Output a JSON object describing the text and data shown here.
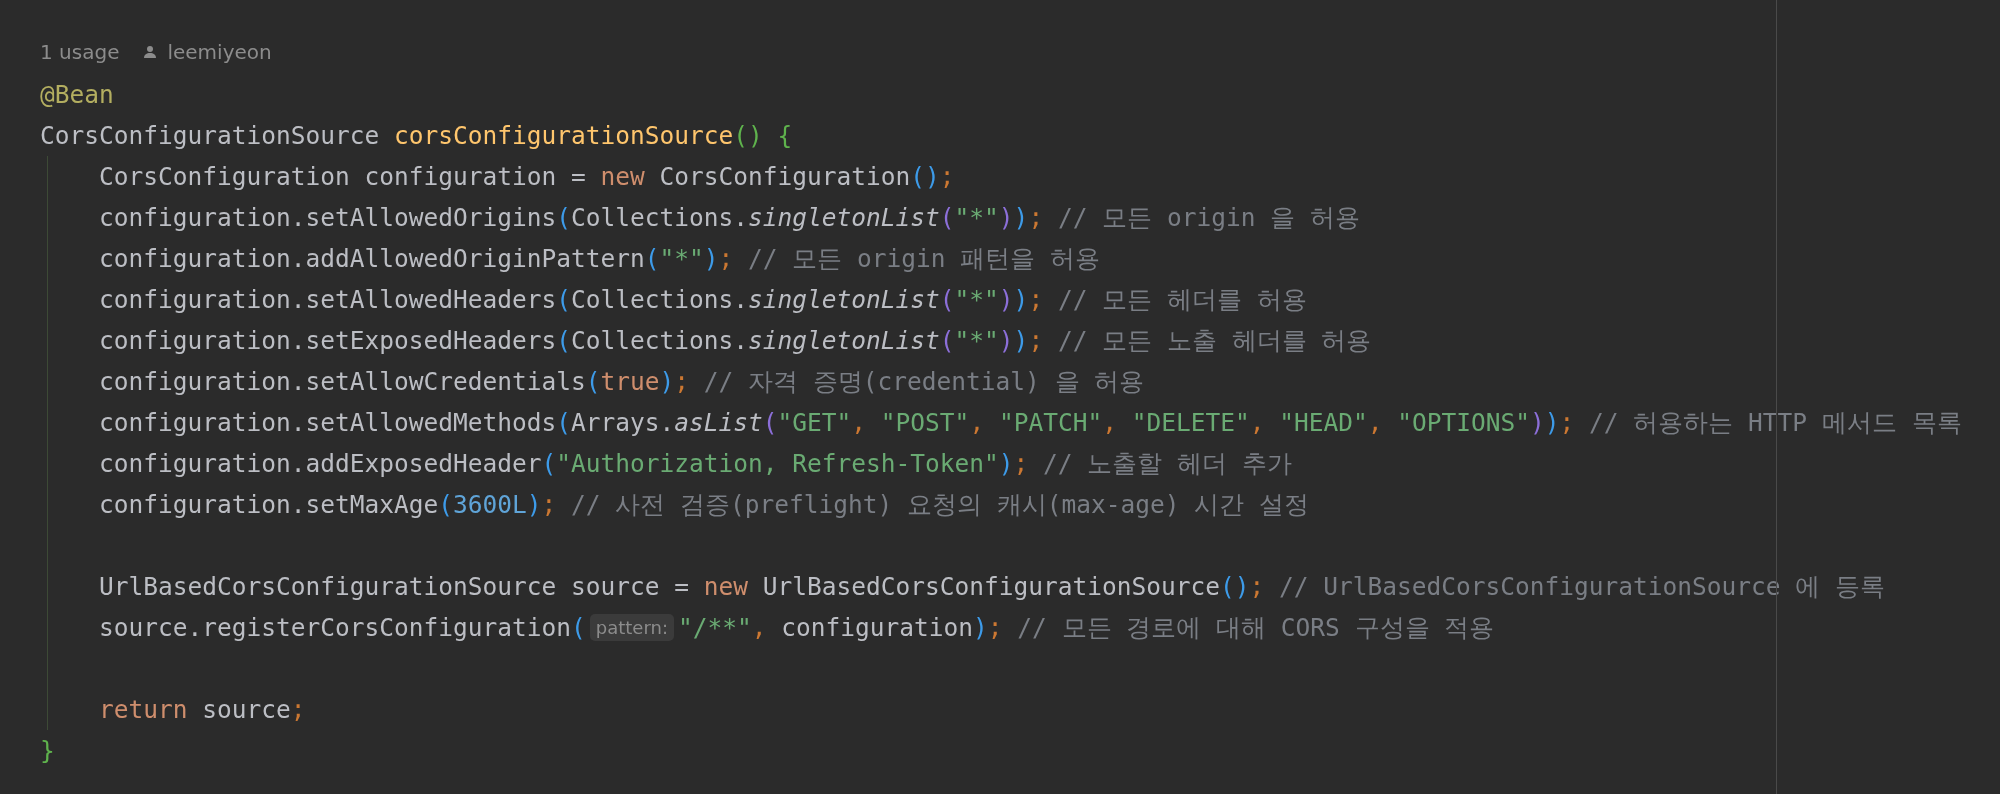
{
  "inlay": {
    "usages": "1 usage",
    "author": "leemiyeon"
  },
  "code": [
    {
      "kind": "code",
      "tokens": [
        {
          "kind": "annotation",
          "text": "@Bean"
        }
      ]
    },
    {
      "kind": "code",
      "tokens": [
        {
          "kind": "plain",
          "text": "CorsConfigurationSource "
        },
        {
          "kind": "declaration",
          "text": "corsConfigurationSource"
        },
        {
          "kind": "brace",
          "text": "()"
        },
        {
          "kind": "brace",
          "text": " {"
        }
      ],
      "children": [
        {
          "kind": "code",
          "tokens": [
            {
              "kind": "plain",
              "text": "CorsConfiguration configuration = "
            },
            {
              "kind": "keyword",
              "text": "new"
            },
            {
              "kind": "plain",
              "text": " CorsConfiguration"
            },
            {
              "kind": "paren1",
              "text": "()"
            },
            {
              "kind": "punct",
              "text": ";"
            }
          ]
        },
        {
          "kind": "code",
          "tokens": [
            {
              "kind": "plain",
              "text": "configuration.setAllowedOrigins"
            },
            {
              "kind": "paren1",
              "text": "("
            },
            {
              "kind": "plain",
              "text": "Collections."
            },
            {
              "kind": "static",
              "text": "singletonList"
            },
            {
              "kind": "paren2",
              "text": "("
            },
            {
              "kind": "string",
              "text": "\"*\""
            },
            {
              "kind": "paren2",
              "text": ")"
            },
            {
              "kind": "paren1",
              "text": ")"
            },
            {
              "kind": "punct",
              "text": ";"
            },
            {
              "kind": "comment",
              "text": " // 모든 origin 을 허용"
            }
          ]
        },
        {
          "kind": "code",
          "tokens": [
            {
              "kind": "plain",
              "text": "configuration.addAllowedOriginPattern"
            },
            {
              "kind": "paren1",
              "text": "("
            },
            {
              "kind": "string",
              "text": "\"*\""
            },
            {
              "kind": "paren1",
              "text": ")"
            },
            {
              "kind": "punct",
              "text": ";"
            },
            {
              "kind": "comment",
              "text": " // 모든 origin 패턴을 허용"
            }
          ]
        },
        {
          "kind": "code",
          "tokens": [
            {
              "kind": "plain",
              "text": "configuration.setAllowedHeaders"
            },
            {
              "kind": "paren1",
              "text": "("
            },
            {
              "kind": "plain",
              "text": "Collections."
            },
            {
              "kind": "static",
              "text": "singletonList"
            },
            {
              "kind": "paren2",
              "text": "("
            },
            {
              "kind": "string",
              "text": "\"*\""
            },
            {
              "kind": "paren2",
              "text": ")"
            },
            {
              "kind": "paren1",
              "text": ")"
            },
            {
              "kind": "punct",
              "text": ";"
            },
            {
              "kind": "comment",
              "text": " // 모든 헤더를 허용"
            }
          ]
        },
        {
          "kind": "code",
          "tokens": [
            {
              "kind": "plain",
              "text": "configuration.setExposedHeaders"
            },
            {
              "kind": "paren1",
              "text": "("
            },
            {
              "kind": "plain",
              "text": "Collections."
            },
            {
              "kind": "static",
              "text": "singletonList"
            },
            {
              "kind": "paren2",
              "text": "("
            },
            {
              "kind": "string",
              "text": "\"*\""
            },
            {
              "kind": "paren2",
              "text": ")"
            },
            {
              "kind": "paren1",
              "text": ")"
            },
            {
              "kind": "punct",
              "text": ";"
            },
            {
              "kind": "comment",
              "text": " // 모든 노출 헤더를 허용"
            }
          ]
        },
        {
          "kind": "code",
          "tokens": [
            {
              "kind": "plain",
              "text": "configuration.setAllowCredentials"
            },
            {
              "kind": "paren1",
              "text": "("
            },
            {
              "kind": "keyword",
              "text": "true"
            },
            {
              "kind": "paren1",
              "text": ")"
            },
            {
              "kind": "punct",
              "text": ";"
            },
            {
              "kind": "comment",
              "text": " // 자격 증명(credential) 을 허용"
            }
          ]
        },
        {
          "kind": "code",
          "tokens": [
            {
              "kind": "plain",
              "text": "configuration.setAllowedMethods"
            },
            {
              "kind": "paren1",
              "text": "("
            },
            {
              "kind": "plain",
              "text": "Arrays."
            },
            {
              "kind": "static",
              "text": "asList"
            },
            {
              "kind": "paren2",
              "text": "("
            },
            {
              "kind": "string",
              "text": "\"GET\""
            },
            {
              "kind": "punct",
              "text": ", "
            },
            {
              "kind": "string",
              "text": "\"POST\""
            },
            {
              "kind": "punct",
              "text": ", "
            },
            {
              "kind": "string",
              "text": "\"PATCH\""
            },
            {
              "kind": "punct",
              "text": ", "
            },
            {
              "kind": "string",
              "text": "\"DELETE\""
            },
            {
              "kind": "punct",
              "text": ", "
            },
            {
              "kind": "string",
              "text": "\"HEAD\""
            },
            {
              "kind": "punct",
              "text": ", "
            },
            {
              "kind": "string",
              "text": "\"OPTIONS\""
            },
            {
              "kind": "paren2",
              "text": ")"
            },
            {
              "kind": "paren1",
              "text": ")"
            },
            {
              "kind": "punct",
              "text": ";"
            },
            {
              "kind": "comment",
              "text": " // 허용하는 HTTP 메서드 목록"
            }
          ]
        },
        {
          "kind": "code",
          "tokens": [
            {
              "kind": "plain",
              "text": "configuration.addExposedHeader"
            },
            {
              "kind": "paren1",
              "text": "("
            },
            {
              "kind": "string",
              "text": "\"Authorization, Refresh-Token\""
            },
            {
              "kind": "paren1",
              "text": ")"
            },
            {
              "kind": "punct",
              "text": ";"
            },
            {
              "kind": "comment",
              "text": " // 노출할 헤더 추가"
            }
          ]
        },
        {
          "kind": "code",
          "tokens": [
            {
              "kind": "plain",
              "text": "configuration.setMaxAge"
            },
            {
              "kind": "paren1",
              "text": "("
            },
            {
              "kind": "number",
              "text": "3600L"
            },
            {
              "kind": "paren1",
              "text": ")"
            },
            {
              "kind": "punct",
              "text": ";"
            },
            {
              "kind": "comment",
              "text": " // 사전 검증(preflight) 요청의 캐시(max-age) 시간 설정"
            }
          ]
        },
        {
          "kind": "blank"
        },
        {
          "kind": "code",
          "tokens": [
            {
              "kind": "plain",
              "text": "UrlBasedCorsConfigurationSource source = "
            },
            {
              "kind": "keyword",
              "text": "new"
            },
            {
              "kind": "plain",
              "text": " UrlBasedCorsConfigurationSource"
            },
            {
              "kind": "paren1",
              "text": "()"
            },
            {
              "kind": "punct",
              "text": ";"
            },
            {
              "kind": "comment",
              "text": " // UrlBasedCorsConfigurationSource 에 등록"
            }
          ]
        },
        {
          "kind": "code",
          "tokens": [
            {
              "kind": "plain",
              "text": "source.registerCorsConfiguration"
            },
            {
              "kind": "paren1",
              "text": "("
            },
            {
              "kind": "hint",
              "text": "pattern:"
            },
            {
              "kind": "string",
              "text": "\"/**\""
            },
            {
              "kind": "punct",
              "text": ","
            },
            {
              "kind": "plain",
              "text": " configuration"
            },
            {
              "kind": "paren1",
              "text": ")"
            },
            {
              "kind": "punct",
              "text": ";"
            },
            {
              "kind": "comment",
              "text": " // 모든 경로에 대해 CORS 구성을 적용"
            }
          ]
        },
        {
          "kind": "blank"
        },
        {
          "kind": "code",
          "tokens": [
            {
              "kind": "keyword",
              "text": "return"
            },
            {
              "kind": "plain",
              "text": " source"
            },
            {
              "kind": "punct",
              "text": ";"
            }
          ]
        }
      ]
    },
    {
      "kind": "code",
      "tokens": [
        {
          "kind": "brace",
          "text": "}"
        }
      ]
    }
  ]
}
